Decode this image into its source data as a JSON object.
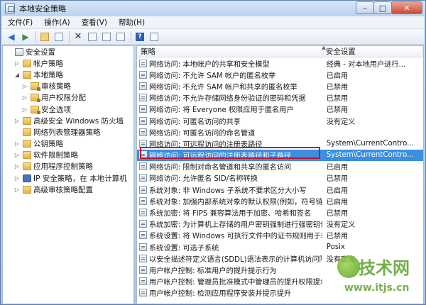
{
  "window": {
    "title": "本地安全策略"
  },
  "window_controls": {
    "minimize": "–",
    "maximize": "□",
    "close": "✕"
  },
  "menubar": [
    {
      "label": "文件(F)"
    },
    {
      "label": "操作(A)"
    },
    {
      "label": "查看(V)"
    },
    {
      "label": "帮助(H)"
    }
  ],
  "toolbar": {
    "icons": [
      "back-arrow-icon",
      "forward-arrow-icon",
      "up-folder-icon",
      "show-tree-icon",
      "delete-icon",
      "properties-icon",
      "refresh-icon",
      "export-icon",
      "help-icon",
      "console-icon"
    ],
    "help_glyph": "?"
  },
  "tree": [
    {
      "label": "安全设置",
      "level": 0,
      "expander": "",
      "icon": "root"
    },
    {
      "label": "帐户策略",
      "level": 1,
      "expander": "▷",
      "icon": "folder"
    },
    {
      "label": "本地策略",
      "level": 1,
      "expander": "◢",
      "icon": "folder"
    },
    {
      "label": "审核策略",
      "level": 2,
      "expander": "▷",
      "icon": "folder-lock"
    },
    {
      "label": "用户权限分配",
      "level": 2,
      "expander": "▷",
      "icon": "folder-lock"
    },
    {
      "label": "安全选项",
      "level": 2,
      "expander": "▷",
      "icon": "folder-lock"
    },
    {
      "label": "高级安全 Windows 防火墙",
      "level": 1,
      "expander": "▷",
      "icon": "folder"
    },
    {
      "label": "网络列表管理器策略",
      "level": 1,
      "expander": "",
      "icon": "folder"
    },
    {
      "label": "公钥策略",
      "level": 1,
      "expander": "▷",
      "icon": "folder"
    },
    {
      "label": "软件限制策略",
      "level": 1,
      "expander": "▷",
      "icon": "folder"
    },
    {
      "label": "应用程序控制策略",
      "level": 1,
      "expander": "▷",
      "icon": "folder"
    },
    {
      "label": "IP 安全策略，在 本地计算机",
      "level": 1,
      "expander": "▷",
      "icon": "net"
    },
    {
      "label": "高级审核策略配置",
      "level": 1,
      "expander": "▷",
      "icon": "folder"
    }
  ],
  "table": {
    "headers": [
      "策略",
      "安全设置"
    ],
    "rows": [
      {
        "policy": "网络访问: 本地帐户的共享和安全模型",
        "setting": "经典 - 对本地用户进行..."
      },
      {
        "policy": "网络访问: 不允许 SAM 帐户的匿名枚举",
        "setting": "已启用"
      },
      {
        "policy": "网络访问: 不允许 SAM 帐户和共享的匿名枚举",
        "setting": "已禁用"
      },
      {
        "policy": "网络访问: 不允许存储网络身份验证的密码和凭据",
        "setting": "已禁用"
      },
      {
        "policy": "网络访问: 将 Everyone 权限应用于匿名用户",
        "setting": "已禁用"
      },
      {
        "policy": "网络访问: 可匿名访问的共享",
        "setting": "没有定义"
      },
      {
        "policy": "网络访问: 可匿名访问的命名管道",
        "setting": ""
      },
      {
        "policy": "网络访问: 可远程访问的注册表路径",
        "setting": "System\\CurrentContro..."
      },
      {
        "policy": "网络访问: 可远程访问的注册表路径和子路径",
        "setting": "System\\CurrentContro...",
        "selected": true
      },
      {
        "policy": "网络访问: 限制对命名管道和共享的匿名访问",
        "setting": "已启用"
      },
      {
        "policy": "网络访问: 允许匿名 SID/名称转换",
        "setting": "已禁用"
      },
      {
        "policy": "系统对象: 非 Windows 子系统不要求区分大小写",
        "setting": "已启用"
      },
      {
        "policy": "系统对象: 加强内部系统对象的默认权限(例如，符号链接)",
        "setting": "已启用"
      },
      {
        "policy": "系统加密: 将 FIPS 兼容算法用于加密、哈希和签名",
        "setting": "已禁用"
      },
      {
        "policy": "系统加密: 为计算机上存储的用户密钥强制进行强密钥保护",
        "setting": "没有定义"
      },
      {
        "policy": "系统设置: 将 Windows 可执行文件中的证书规则用于软件...",
        "setting": "已禁用"
      },
      {
        "policy": "系统设置: 可选子系统",
        "setting": "Posix"
      },
      {
        "policy": "以安全描述符定义语言(SDDL)语法表示的计算机访问限制",
        "setting": "没有定义"
      },
      {
        "policy": "用户帐户控制: 标准用户的提升提示行为",
        "setting": ""
      },
      {
        "policy": "用户帐户控制: 管理员批准模式中管理员的提升权限提示的...",
        "setting": ""
      },
      {
        "policy": "用户帐户控制: 检测应用程序安装并提示提升",
        "setting": ""
      }
    ]
  },
  "watermark": {
    "brand": "技术网",
    "url": "www.itjs.cn"
  },
  "colors": {
    "selection": "#3a8fe0",
    "highlight_box": "#c8102e",
    "watermark_green": "#5aa02a"
  }
}
